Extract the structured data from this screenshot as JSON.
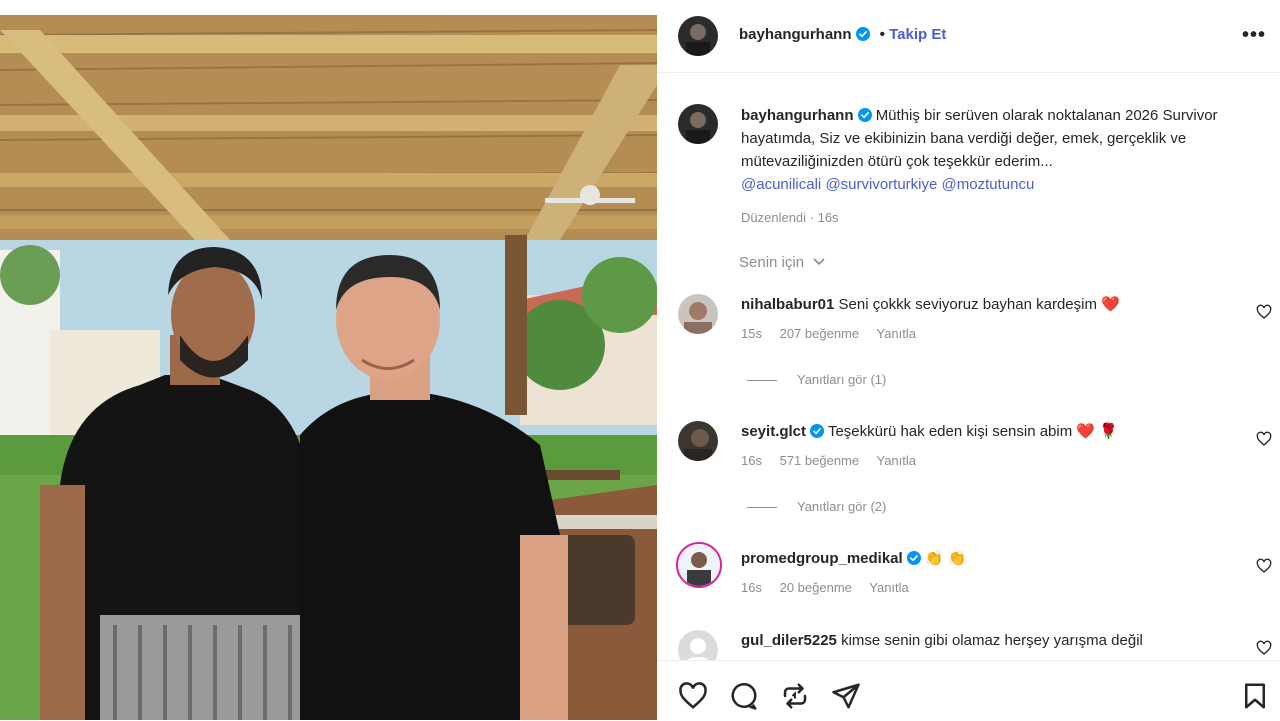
{
  "post": {
    "username": "bayhangurhann",
    "separator": "•",
    "follow_label": "Takip Et",
    "more_label": "•••",
    "caption_text": "Müthiş bir serüven olarak noktalanan 2026 Survivor hayatımda, Siz ve ekibinizin bana verdiği değer, emek, gerçeklik ve mütevaziliğinizden ötürü çok teşekkür ederim...",
    "mentions": [
      "@acunilicali",
      "@survivorturkiye",
      "@moztutuncu"
    ],
    "edited_meta": "Düzenlendi · 16s",
    "filter_label": "Senin için"
  },
  "comments": [
    {
      "username": "nihalbabur01",
      "text": "Seni çokkk seviyoruz bayhan kardeşim",
      "emoji": "❤️",
      "time": "15s",
      "likes": "207 beğenme",
      "reply_label": "Yanıtla",
      "view_replies": "Yanıtları gör (1)"
    },
    {
      "username": "seyit.glct",
      "text": "Teşekkürü hak eden kişi sensin abim",
      "emoji": "❤️ 🌹",
      "time": "16s",
      "likes": "571 beğenme",
      "reply_label": "Yanıtla",
      "view_replies": "Yanıtları gör (2)"
    },
    {
      "username": "promedgroup_medikal",
      "text": "",
      "emoji": "👏 👏",
      "time": "16s",
      "likes": "20 beğenme",
      "reply_label": "Yanıtla"
    },
    {
      "username": "gul_diler5225",
      "text": "kimse senin gibi olamaz herşey yarışma değil"
    }
  ],
  "icons": {
    "like": "heart-outline-icon",
    "comment": "speech-bubble-icon",
    "share": "repost-icon",
    "send": "paper-plane-icon",
    "save": "bookmark-icon"
  },
  "colors": {
    "link": "#4a5fd0",
    "verified": "#0095f6",
    "muted": "#8e8e8e",
    "heart": "#ed4956"
  }
}
